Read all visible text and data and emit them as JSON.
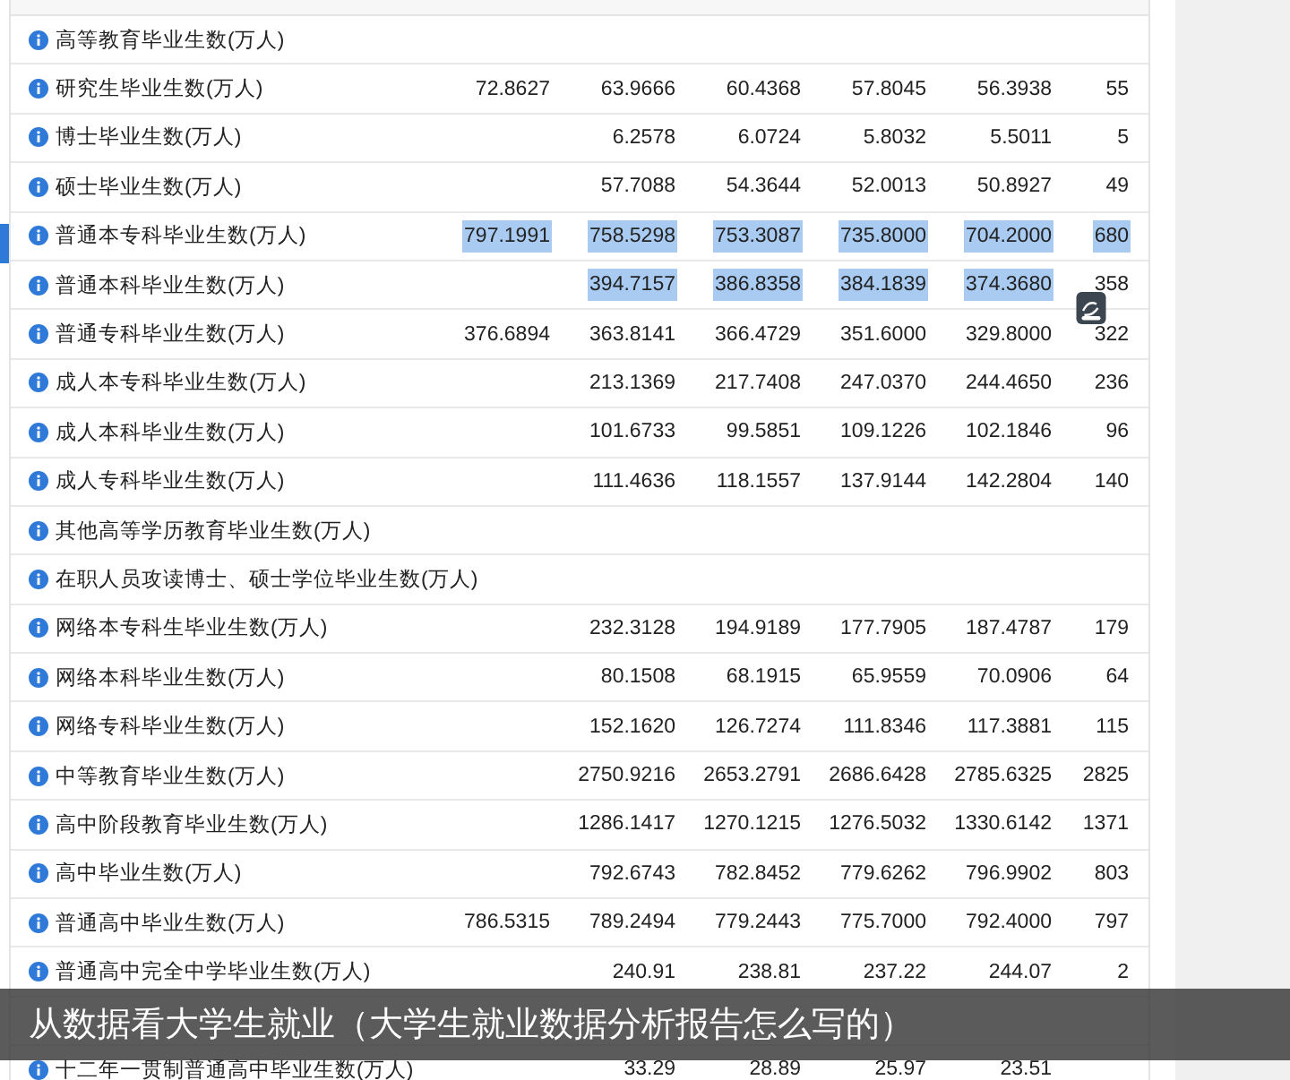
{
  "table": {
    "rows": [
      {
        "label": "高等教育毕业生数(万人)",
        "cells": []
      },
      {
        "label": "研究生毕业生数(万人)",
        "cells": [
          {
            "text": "72.8627",
            "selected": false
          },
          {
            "text": "63.9666",
            "selected": false
          },
          {
            "text": "60.4368",
            "selected": false
          },
          {
            "text": "57.8045",
            "selected": false
          },
          {
            "text": "56.3938",
            "selected": false
          },
          {
            "text": "55",
            "selected": false
          }
        ]
      },
      {
        "label": "博士毕业生数(万人)",
        "cells": [
          null,
          {
            "text": "6.2578",
            "selected": false
          },
          {
            "text": "6.0724",
            "selected": false
          },
          {
            "text": "5.8032",
            "selected": false
          },
          {
            "text": "5.5011",
            "selected": false
          },
          {
            "text": "5",
            "selected": false
          }
        ]
      },
      {
        "label": "硕士毕业生数(万人)",
        "cells": [
          null,
          {
            "text": "57.7088",
            "selected": false
          },
          {
            "text": "54.3644",
            "selected": false
          },
          {
            "text": "52.0013",
            "selected": false
          },
          {
            "text": "50.8927",
            "selected": false
          },
          {
            "text": "49",
            "selected": false
          }
        ]
      },
      {
        "label": "普通本专科毕业生数(万人)",
        "cells": [
          {
            "text": "797.1991",
            "selected": true
          },
          {
            "text": "758.5298",
            "selected": true
          },
          {
            "text": "753.3087",
            "selected": true
          },
          {
            "text": "735.8000",
            "selected": true
          },
          {
            "text": "704.2000",
            "selected": true
          },
          {
            "text": "680",
            "selected": true
          }
        ]
      },
      {
        "label": "普通本科毕业生数(万人)",
        "cells": [
          null,
          {
            "text": "394.7157",
            "selected": true
          },
          {
            "text": "386.8358",
            "selected": true
          },
          {
            "text": "384.1839",
            "selected": true
          },
          {
            "text": "374.3680",
            "selected": true
          },
          {
            "text": "358",
            "selected": false
          }
        ]
      },
      {
        "label": "普通专科毕业生数(万人)",
        "cells": [
          {
            "text": "376.6894",
            "selected": false
          },
          {
            "text": "363.8141",
            "selected": false
          },
          {
            "text": "366.4729",
            "selected": false
          },
          {
            "text": "351.6000",
            "selected": false
          },
          {
            "text": "329.8000",
            "selected": false
          },
          {
            "text": "322",
            "selected": false
          }
        ]
      },
      {
        "label": "成人本专科毕业生数(万人)",
        "cells": [
          null,
          {
            "text": "213.1369",
            "selected": false
          },
          {
            "text": "217.7408",
            "selected": false
          },
          {
            "text": "247.0370",
            "selected": false
          },
          {
            "text": "244.4650",
            "selected": false
          },
          {
            "text": "236",
            "selected": false
          }
        ]
      },
      {
        "label": "成人本科毕业生数(万人)",
        "cells": [
          null,
          {
            "text": "101.6733",
            "selected": false
          },
          {
            "text": "99.5851",
            "selected": false
          },
          {
            "text": "109.1226",
            "selected": false
          },
          {
            "text": "102.1846",
            "selected": false
          },
          {
            "text": "96",
            "selected": false
          }
        ]
      },
      {
        "label": "成人专科毕业生数(万人)",
        "cells": [
          null,
          {
            "text": "111.4636",
            "selected": false
          },
          {
            "text": "118.1557",
            "selected": false
          },
          {
            "text": "137.9144",
            "selected": false
          },
          {
            "text": "142.2804",
            "selected": false
          },
          {
            "text": "140",
            "selected": false
          }
        ]
      },
      {
        "label": "其他高等学历教育毕业生数(万人)",
        "cells": []
      },
      {
        "label": "在职人员攻读博士、硕士学位毕业生数(万人)",
        "cells": []
      },
      {
        "label": "网络本专科生毕业生数(万人)",
        "cells": [
          null,
          {
            "text": "232.3128",
            "selected": false
          },
          {
            "text": "194.9189",
            "selected": false
          },
          {
            "text": "177.7905",
            "selected": false
          },
          {
            "text": "187.4787",
            "selected": false
          },
          {
            "text": "179",
            "selected": false
          }
        ]
      },
      {
        "label": "网络本科毕业生数(万人)",
        "cells": [
          null,
          {
            "text": "80.1508",
            "selected": false
          },
          {
            "text": "68.1915",
            "selected": false
          },
          {
            "text": "65.9559",
            "selected": false
          },
          {
            "text": "70.0906",
            "selected": false
          },
          {
            "text": "64",
            "selected": false
          }
        ]
      },
      {
        "label": "网络专科毕业生数(万人)",
        "cells": [
          null,
          {
            "text": "152.1620",
            "selected": false
          },
          {
            "text": "126.7274",
            "selected": false
          },
          {
            "text": "111.8346",
            "selected": false
          },
          {
            "text": "117.3881",
            "selected": false
          },
          {
            "text": "115",
            "selected": false
          }
        ]
      },
      {
        "label": "中等教育毕业生数(万人)",
        "cells": [
          null,
          {
            "text": "2750.9216",
            "selected": false
          },
          {
            "text": "2653.2791",
            "selected": false
          },
          {
            "text": "2686.6428",
            "selected": false
          },
          {
            "text": "2785.6325",
            "selected": false
          },
          {
            "text": "2825",
            "selected": false
          }
        ]
      },
      {
        "label": "高中阶段教育毕业生数(万人)",
        "cells": [
          null,
          {
            "text": "1286.1417",
            "selected": false
          },
          {
            "text": "1270.1215",
            "selected": false
          },
          {
            "text": "1276.5032",
            "selected": false
          },
          {
            "text": "1330.6142",
            "selected": false
          },
          {
            "text": "1371",
            "selected": false
          }
        ]
      },
      {
        "label": "高中毕业生数(万人)",
        "cells": [
          null,
          {
            "text": "792.6743",
            "selected": false
          },
          {
            "text": "782.8452",
            "selected": false
          },
          {
            "text": "779.6262",
            "selected": false
          },
          {
            "text": "796.9902",
            "selected": false
          },
          {
            "text": "803",
            "selected": false
          }
        ]
      },
      {
        "label": "普通高中毕业生数(万人)",
        "cells": [
          {
            "text": "786.5315",
            "selected": false
          },
          {
            "text": "789.2494",
            "selected": false
          },
          {
            "text": "779.2443",
            "selected": false
          },
          {
            "text": "775.7000",
            "selected": false
          },
          {
            "text": "792.4000",
            "selected": false
          },
          {
            "text": "797",
            "selected": false
          }
        ]
      },
      {
        "label": "普通高中完全中学毕业生数(万人)",
        "cells": [
          null,
          {
            "text": "240.91",
            "selected": false
          },
          {
            "text": "238.81",
            "selected": false
          },
          {
            "text": "237.22",
            "selected": false
          },
          {
            "text": "244.07",
            "selected": false
          },
          {
            "text": "2",
            "selected": false
          }
        ]
      },
      {
        "cells": []
      },
      {
        "label": "十二年一贯制普通高中毕业生数(万人)",
        "cells": [
          null,
          {
            "text": "33.29",
            "selected": false
          },
          {
            "text": "28.89",
            "selected": false
          },
          {
            "text": "25.97",
            "selected": false
          },
          {
            "text": "23.51",
            "selected": false
          }
        ]
      }
    ]
  },
  "caption": "从数据看大学生就业（大学生就业数据分析报告怎么写的）"
}
